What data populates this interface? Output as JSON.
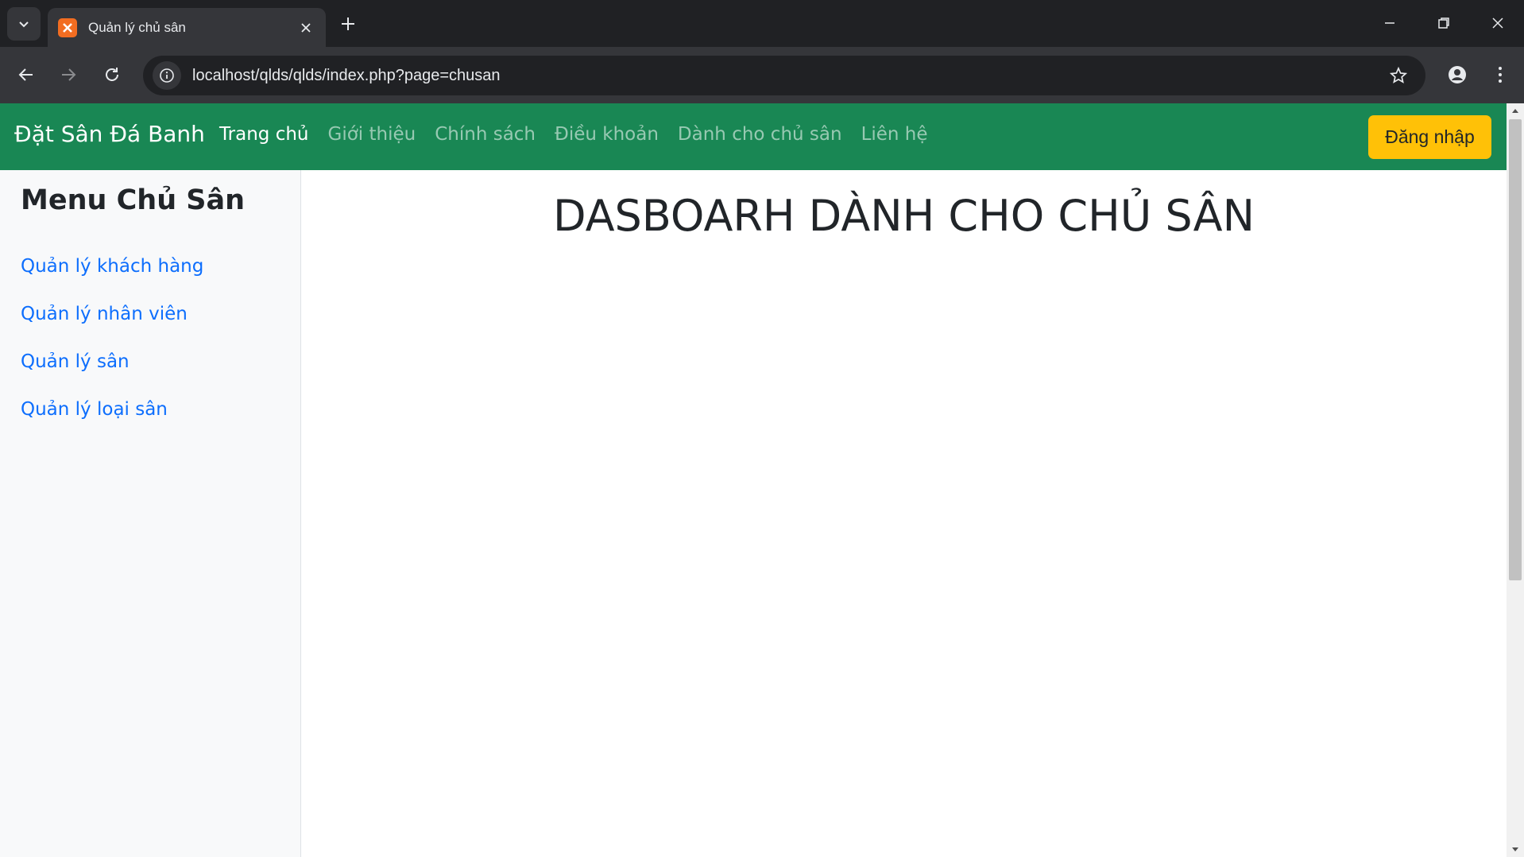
{
  "browser": {
    "tab_title": "Quản lý chủ sân",
    "url": "localhost/qlds/qlds/index.php?page=chusan",
    "icons": [
      "tab-search-icon",
      "favicon-icon",
      "close-icon",
      "plus-icon",
      "minimize-icon",
      "restore-icon",
      "window-close-icon",
      "back-icon",
      "forward-icon",
      "reload-icon",
      "site-info-icon",
      "star-icon",
      "profile-icon",
      "more-vertical-icon"
    ]
  },
  "navbar": {
    "brand": "Đặt Sân Đá Banh",
    "links": [
      "Trang chủ",
      "Giới thiệu",
      "Chính sách",
      "Điều khoản",
      "Dành cho chủ sân",
      "Liên hệ"
    ],
    "active_link": "Trang chủ",
    "login_label": "Đăng nhập",
    "bg_color": "#198754",
    "login_color": "#ffc107"
  },
  "sidebar": {
    "title": "Menu Chủ Sân",
    "items": [
      "Quản lý khách hàng",
      "Quản lý nhân viên",
      "Quản lý sân",
      "Quản lý loại sân"
    ],
    "link_color": "#0d6efd"
  },
  "main": {
    "title": "DASBOARH DÀNH CHO CHỦ SÂN"
  }
}
